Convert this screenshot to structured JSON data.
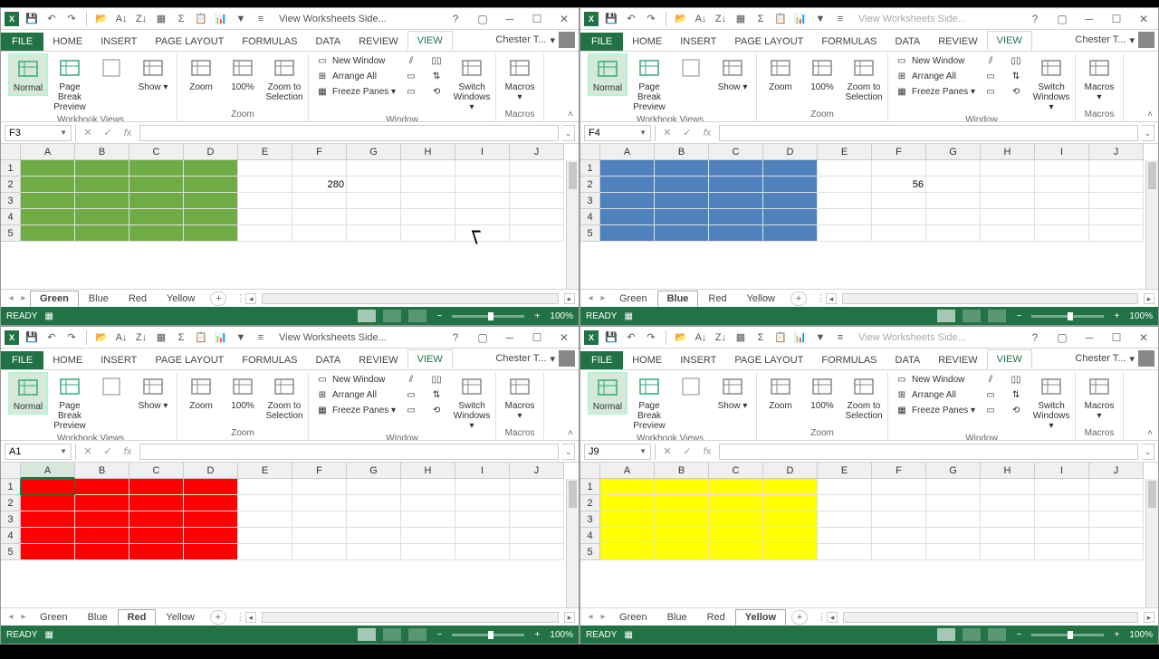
{
  "qat_title": "View Worksheets Side...",
  "tabs": {
    "file": "FILE",
    "home": "HOME",
    "insert": "INSERT",
    "pagelayout": "PAGE LAYOUT",
    "formulas": "FORMULAS",
    "data": "DATA",
    "review": "REVIEW",
    "view": "VIEW"
  },
  "user": "Chester T...",
  "ribbon": {
    "views": {
      "normal": "Normal",
      "pbp": "Page Break Preview",
      "show": "Show",
      "group": "Workbook Views"
    },
    "zoom": {
      "zoom": "Zoom",
      "z100": "100%",
      "zsel": "Zoom to Selection",
      "group": "Zoom"
    },
    "window": {
      "new": "New Window",
      "arrange": "Arrange All",
      "freeze": "Freeze Panes",
      "switch": "Switch Windows",
      "group": "Window"
    },
    "macros": {
      "macros": "Macros",
      "group": "Macros"
    }
  },
  "sheet_tabs": [
    "Green",
    "Blue",
    "Red",
    "Yellow"
  ],
  "columns": [
    "A",
    "B",
    "C",
    "D",
    "E",
    "F",
    "G",
    "H",
    "I",
    "J"
  ],
  "rows": [
    "1",
    "2",
    "3",
    "4",
    "5"
  ],
  "status": {
    "ready": "READY",
    "zoom": "100%"
  },
  "panes": [
    {
      "namebox": "F3",
      "active_tab": "Green",
      "fill": "#6fac46",
      "cellval": "280",
      "val_col": 5,
      "selected_col": -1,
      "selcell": [
        -1,
        -1
      ]
    },
    {
      "namebox": "F4",
      "active_tab": "Blue",
      "fill": "#4f81bd",
      "cellval": "56",
      "val_col": 5,
      "selected_col": -1,
      "selcell": [
        -1,
        -1
      ]
    },
    {
      "namebox": "A1",
      "active_tab": "Red",
      "fill": "#ff0000",
      "cellval": "",
      "val_col": -1,
      "selected_col": 0,
      "selcell": [
        0,
        0
      ]
    },
    {
      "namebox": "J9",
      "active_tab": "Yellow",
      "fill": "#ffff00",
      "cellval": "",
      "val_col": -1,
      "selected_col": -1,
      "selcell": [
        -1,
        -1
      ]
    }
  ],
  "chart_data": {
    "type": "table",
    "title": "Four Excel windows side-by-side showing different colored sheets",
    "series": [
      {
        "name": "Green",
        "values": [
          280
        ]
      },
      {
        "name": "Blue",
        "values": [
          56
        ]
      },
      {
        "name": "Red",
        "values": []
      },
      {
        "name": "Yellow",
        "values": []
      }
    ]
  }
}
